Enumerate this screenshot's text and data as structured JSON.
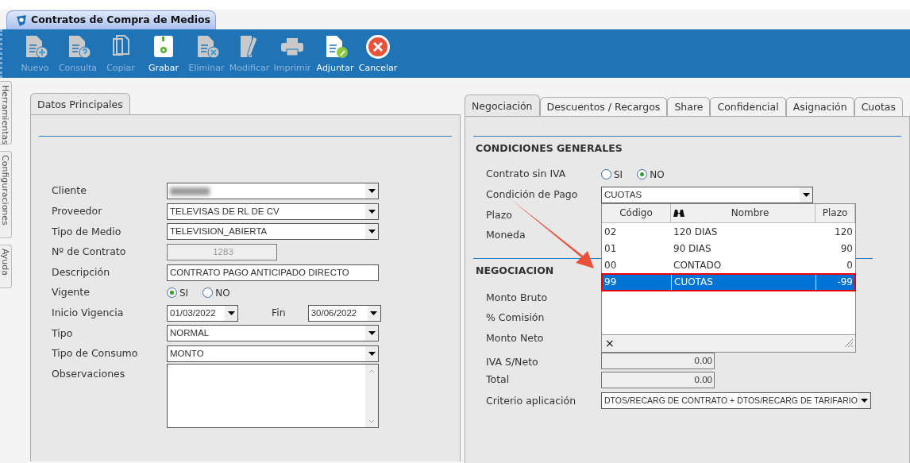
{
  "window": {
    "title": "Contratos de Compra de Medios"
  },
  "toolbar": [
    {
      "label": "Nuevo",
      "kind": "new",
      "disabled": true
    },
    {
      "label": "Consulta",
      "kind": "query",
      "disabled": true
    },
    {
      "label": "Copiar",
      "kind": "copy",
      "disabled": true
    },
    {
      "label": "Grabar",
      "kind": "save",
      "disabled": false
    },
    {
      "label": "Eliminar",
      "kind": "delete",
      "disabled": true
    },
    {
      "label": "Modificar",
      "kind": "edit",
      "disabled": true
    },
    {
      "label": "Imprimir",
      "kind": "print",
      "disabled": true
    },
    {
      "label": "Adjuntar",
      "kind": "attach",
      "disabled": false
    },
    {
      "label": "Cancelar",
      "kind": "cancel",
      "disabled": false
    }
  ],
  "side_tabs": [
    "Herramientas",
    "Configuraciones",
    "Ayuda"
  ],
  "left_panel": {
    "tabs": [
      {
        "label": "Datos Principales",
        "selected": true
      }
    ],
    "fields": [
      {
        "label": "Cliente",
        "kind": "select",
        "blurred": true
      },
      {
        "label": "Proveedor",
        "kind": "select",
        "value": "TELEVISAS DE RL DE CV"
      },
      {
        "label": "Tipo de Medio",
        "kind": "select",
        "value": "TELEVISION_ABIERTA"
      },
      {
        "label": "Nº de Contrato",
        "kind": "readonly",
        "value": "1283",
        "disabled": true
      },
      {
        "label": "Descripción",
        "kind": "text",
        "value": "CONTRATO PAGO ANTICIPADO DIRECTO"
      },
      {
        "label": "Vigente",
        "kind": "radio",
        "options": [
          {
            "label": "SI",
            "selected": true
          },
          {
            "label": "NO",
            "selected": false
          }
        ]
      },
      {
        "label": "Inicio Vigencia",
        "kind": "daterange",
        "value": "01/03/2022",
        "end_label": "Fin",
        "end_value": "30/06/2022"
      },
      {
        "label": "Tipo",
        "kind": "select",
        "value": "NORMAL"
      },
      {
        "label": "Tipo de Consumo",
        "kind": "select",
        "value": "MONTO"
      },
      {
        "label": "Observaciones",
        "kind": "textarea"
      }
    ]
  },
  "right_panel": {
    "tabs": [
      {
        "label": "Negociación",
        "selected": true
      },
      {
        "label": "Descuentos / Recargos",
        "selected": false
      },
      {
        "label": "Share",
        "selected": false
      },
      {
        "label": "Confidencial",
        "selected": false
      },
      {
        "label": "Asignación",
        "selected": false
      },
      {
        "label": "Cuotas",
        "selected": false
      }
    ],
    "sections": [
      {
        "title": "CONDICIONES GENERALES",
        "fields": [
          {
            "label": "Contrato sin IVA",
            "kind": "radio",
            "options": [
              {
                "label": "SI",
                "selected": false
              },
              {
                "label": "NO",
                "selected": true
              }
            ]
          },
          {
            "label": "Condición de Pago",
            "kind": "combo",
            "value": "CUOTAS"
          },
          {
            "label": "Plazo",
            "kind": "label"
          },
          {
            "label": "Moneda",
            "kind": "label"
          }
        ]
      },
      {
        "title": "NEGOCIACION",
        "fields": [
          {
            "label": "Monto Bruto",
            "kind": "label"
          },
          {
            "label": "% Comisión",
            "kind": "label"
          },
          {
            "label": "Monto Neto",
            "kind": "label"
          },
          {
            "label": "IVA S/Neto",
            "kind": "amount",
            "value": "0.00"
          },
          {
            "label": "Total",
            "kind": "amount",
            "value": "0.00"
          },
          {
            "label": "Criterio aplicación",
            "kind": "select",
            "value": "DTOS/RECARG DE CONTRATO + DTOS/RECARG DE TARIFARIO"
          }
        ]
      }
    ]
  },
  "dropdown_popup": {
    "columns": [
      "Código",
      "Nombre",
      "Plazo"
    ],
    "rows": [
      {
        "cells": [
          "02",
          "120 DIAS",
          "120"
        ],
        "selected": false
      },
      {
        "cells": [
          "01",
          "90 DIAS",
          "90"
        ],
        "selected": false
      },
      {
        "cells": [
          "00",
          "CONTADO",
          "0"
        ],
        "selected": false
      },
      {
        "cells": [
          "99",
          "CUOTAS",
          "-99"
        ],
        "selected": true
      }
    ],
    "close": "×"
  }
}
